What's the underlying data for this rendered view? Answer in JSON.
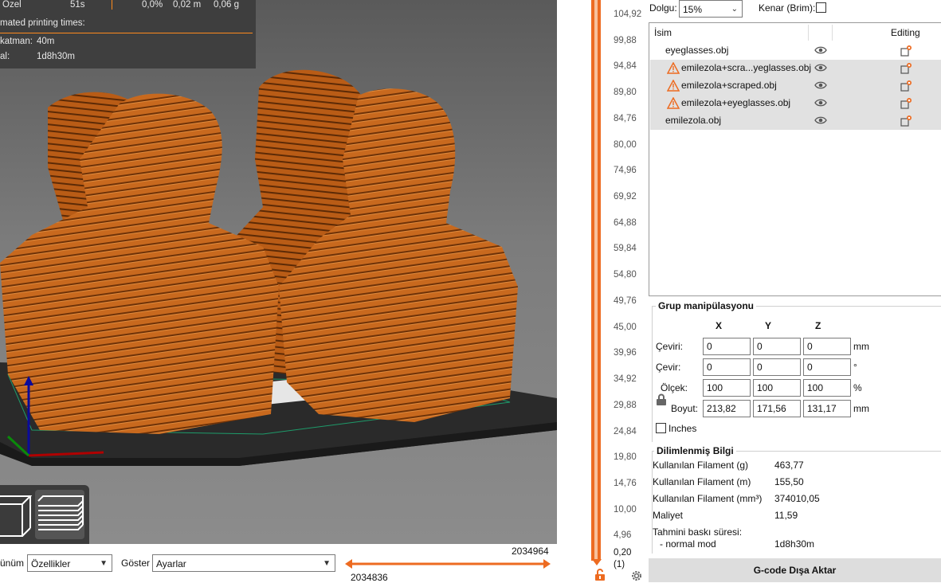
{
  "legend": {
    "row_label": "Özel",
    "row_time": "51s",
    "row_percent": "0,0%",
    "row_length": "0,02 m",
    "row_weight": "0,06 g",
    "estimated_title": "mated printing times:",
    "first_layer_label": "katman:",
    "first_layer_value": "40m",
    "total_label": "al:",
    "total_value": "1d8h30m"
  },
  "bottom_bar": {
    "view_label": "ünüm",
    "view_value": "Özellikler",
    "show_label": "Göster",
    "show_value": "Ayarlar",
    "range_top": "2034964",
    "range_bottom": "2034836"
  },
  "layer_slider": {
    "ticks": [
      "104,92",
      "99,88",
      "94,84",
      "89,80",
      "84,76",
      "80,00",
      "74,96",
      "69,92",
      "64,88",
      "59,84",
      "54,80",
      "49,76",
      "45,00",
      "39,96",
      "34,92",
      "29,88",
      "24,84",
      "19,80",
      "14,76",
      "10,00",
      "4,96"
    ],
    "bottom_value": "0,20",
    "bottom_layer": "(1)"
  },
  "top_options": {
    "infill_label": "Dolgu:",
    "infill_value": "15%",
    "brim_label": "Kenar (Brim):"
  },
  "object_list": {
    "col_name": "İsim",
    "col_editing": "Editing",
    "items": [
      {
        "name": "eyeglasses.obj",
        "warning": false,
        "selected": false
      },
      {
        "name": "emilezola+scra...yeglasses.obj",
        "warning": true,
        "selected": true
      },
      {
        "name": "emilezola+scraped.obj",
        "warning": true,
        "selected": true
      },
      {
        "name": "emilezola+eyeglasses.obj",
        "warning": true,
        "selected": true
      },
      {
        "name": "emilezola.obj",
        "warning": false,
        "selected": true
      }
    ]
  },
  "manipulation": {
    "title": "Grup manipülasyonu",
    "axes": [
      "X",
      "Y",
      "Z"
    ],
    "rows": [
      {
        "label": "Çeviri:",
        "values": [
          "0",
          "0",
          "0"
        ],
        "unit": "mm"
      },
      {
        "label": "Çevir:",
        "values": [
          "0",
          "0",
          "0"
        ],
        "unit": "°"
      },
      {
        "label": "Ölçek:",
        "values": [
          "100",
          "100",
          "100"
        ],
        "unit": "%"
      },
      {
        "label": "Boyut:",
        "values": [
          "213,82",
          "171,56",
          "131,17"
        ],
        "unit": "mm"
      }
    ],
    "inches_label": "Inches"
  },
  "sliced_info": {
    "title": "Dilimlenmiş Bilgi",
    "filament_g_label": "Kullanılan Filament (g)",
    "filament_g_value": "463,77",
    "filament_m_label": "Kullanılan Filament (m)",
    "filament_m_value": "155,50",
    "filament_mm3_label": "Kullanılan Filament (mm³)",
    "filament_mm3_value": "374010,05",
    "cost_label": "Maliyet",
    "cost_value": "11,59",
    "time_label": "Tahmini baskı süresi:",
    "mode_label": "- normal mod",
    "mode_value": "1d8h30m"
  },
  "export_label": "G-code Dışa Aktar",
  "colors": {
    "accent": "#ED6B21",
    "model": "#C8691E",
    "legend_bg": "#3C3C3C"
  }
}
